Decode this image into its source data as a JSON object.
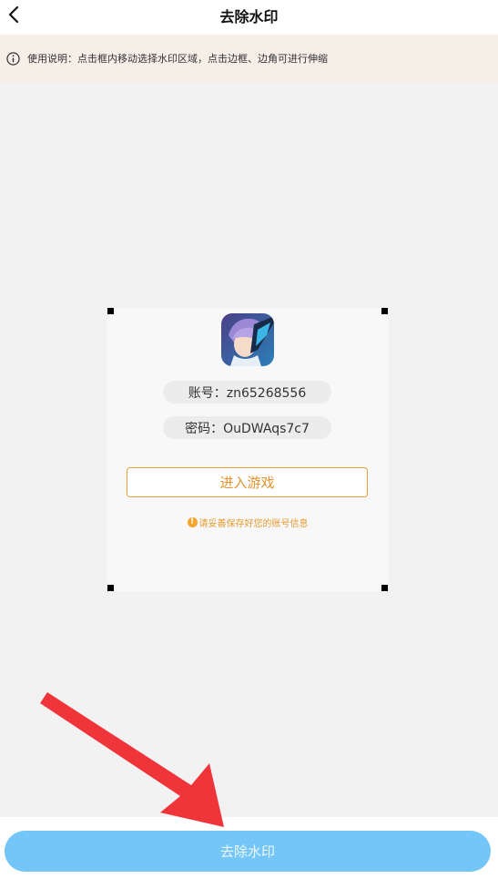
{
  "header": {
    "title": "去除水印"
  },
  "notice": {
    "text": "使用说明：点击框内移动选择水印区域，点击边框、边角可进行伸缩"
  },
  "card": {
    "account_text": "账号：zn65268556",
    "password_text": "密码：OuDWAqs7c7",
    "enter_button_label": "进入游戏",
    "tip_text": "请妥善保存好您的账号信息",
    "tip_icon": "!"
  },
  "footer": {
    "remove_button_label": "去除水印"
  },
  "colors": {
    "accent_orange": "#e39330",
    "primary_blue": "#74c6f6",
    "arrow_red": "#f0353a"
  }
}
